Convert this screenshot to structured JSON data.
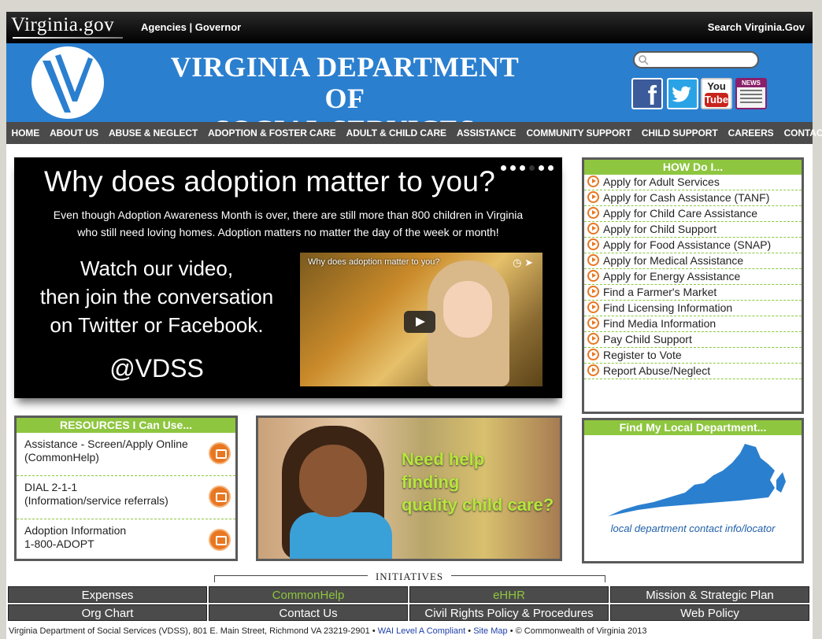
{
  "topbar": {
    "logo": "Virginia.gov",
    "agencies": "Agencies",
    "separator": "|",
    "governor": "Governor",
    "search": "Search Virginia.Gov"
  },
  "header": {
    "title_line1": "VIRGINIA DEPARTMENT OF",
    "title_line2": "SOCIAL SERVICES",
    "search_placeholder": "",
    "social": {
      "facebook": "f",
      "youtube_top": "You",
      "youtube_bottom": "Tube",
      "news": "NEWS"
    }
  },
  "nav": [
    "HOME",
    "ABOUT US",
    "ABUSE & NEGLECT",
    "ADOPTION & FOSTER CARE",
    "ADULT & CHILD CARE",
    "ASSISTANCE",
    "COMMUNITY SUPPORT",
    "CHILD SUPPORT",
    "CAREERS",
    "CONTACT US"
  ],
  "hero": {
    "title": "Why does adoption matter to you?",
    "sub_line1": "Even though Adoption Awareness Month is over, there are still more than 800 children in Virginia",
    "sub_line2": "who still need loving homes. Adoption matters no matter the day of the week or month!",
    "watch_line1": "Watch our video,",
    "watch_line2": "then join the conversation",
    "watch_line3": "on Twitter or Facebook.",
    "handle": "@VDSS",
    "video_title": "Why does adoption matter to you?"
  },
  "howdoi": {
    "heading": "HOW Do I...",
    "items": [
      "Apply for Adult Services",
      "Apply for Cash Assistance (TANF)",
      "Apply for Child Care Assistance",
      "Apply for Child Support",
      "Apply for Food Assistance (SNAP)",
      "Apply for Medical Assistance",
      "Apply for Energy Assistance",
      "Find a Farmer's Market",
      "Find Licensing Information",
      "Find Media Information",
      "Pay Child Support",
      "Register to Vote",
      "Report Abuse/Neglect"
    ]
  },
  "resources": {
    "heading": "RESOURCES I Can Use...",
    "items": [
      {
        "line1": "Assistance - Screen/Apply Online",
        "line2": "(CommonHelp)"
      },
      {
        "line1": "DIAL 2-1-1",
        "line2": "(Information/service referrals)"
      },
      {
        "line1": "Adoption Information",
        "line2": "1-800-ADOPT"
      }
    ]
  },
  "promo": {
    "line1": "Need help",
    "line2": "finding",
    "line3": "quality child care?"
  },
  "localdept": {
    "heading": "Find My Local Department...",
    "link": "local department contact info/locator"
  },
  "initiatives": {
    "label": "INITIATIVES",
    "links": [
      "Expenses",
      "CommonHelp",
      "eHHR",
      "Mission & Strategic Plan",
      "Org Chart",
      "Contact Us",
      "Civil Rights Policy & Procedures",
      "Web Policy"
    ]
  },
  "footer": {
    "address": "Virginia Department of Social Services (VDSS), 801 E. Main Street, Richmond VA 23219-2901 •",
    "wai": "WAI Level A Compliant",
    "bullet": "•",
    "sitemap": "Site Map",
    "copyright": "• © Commonwealth of Virginia 2013"
  },
  "colors": {
    "header_blue": "#2b7fcf",
    "accent_green": "#8ec63f",
    "accent_orange": "#e87722",
    "nav_gray": "#4b4b4b"
  }
}
